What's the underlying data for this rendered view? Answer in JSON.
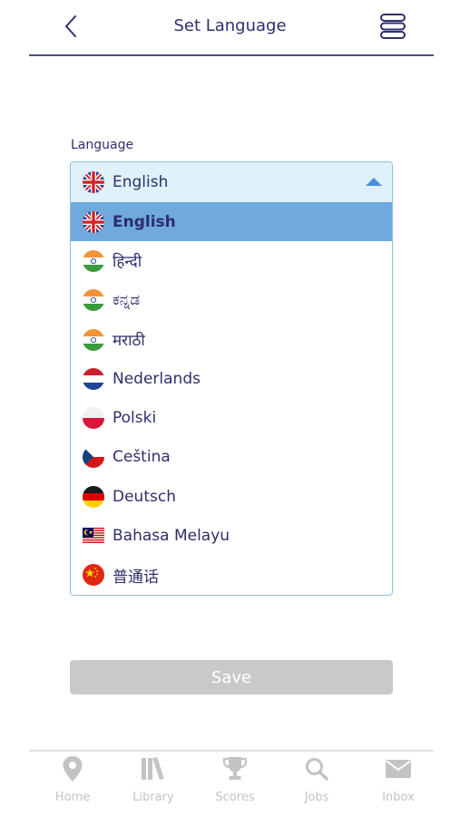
{
  "header": {
    "title": "Set Language",
    "back_icon": "chevron-left-icon",
    "menu_icon": "stacked-menu-icon"
  },
  "form": {
    "label": "Language",
    "selected": {
      "label": "English",
      "flag": "uk-flag-icon"
    },
    "options": [
      {
        "label": "English",
        "flag": "uk-flag-icon",
        "selected": true
      },
      {
        "label": "हिन्दी",
        "flag": "india-flag-icon"
      },
      {
        "label": "ಕನ್ನಡ",
        "flag": "india-flag-icon"
      },
      {
        "label": "मराठी",
        "flag": "india-flag-icon"
      },
      {
        "label": "Nederlands",
        "flag": "netherlands-flag-icon"
      },
      {
        "label": "Polski",
        "flag": "poland-flag-icon"
      },
      {
        "label": "Ceština",
        "flag": "czech-flag-icon"
      },
      {
        "label": "Deutsch",
        "flag": "germany-flag-icon"
      },
      {
        "label": "Bahasa Melayu",
        "flag": "malaysia-flag-icon"
      },
      {
        "label": "普通话",
        "flag": "china-flag-icon"
      }
    ],
    "save_label": "Save"
  },
  "bottom_nav": [
    {
      "label": "Home",
      "icon": "map-pin-icon"
    },
    {
      "label": "Library",
      "icon": "books-icon"
    },
    {
      "label": "Scores",
      "icon": "trophy-icon"
    },
    {
      "label": "Jobs",
      "icon": "search-icon"
    },
    {
      "label": "Inbox",
      "icon": "envelope-icon"
    }
  ],
  "colors": {
    "text": "#2e2f6b",
    "accent": "#4a90d6",
    "selected_row": "#6fa9dd",
    "select_head_bg": "#dff1fb",
    "save_disabled": "#c9c9c9",
    "nav_inactive": "#c3c3c3"
  }
}
